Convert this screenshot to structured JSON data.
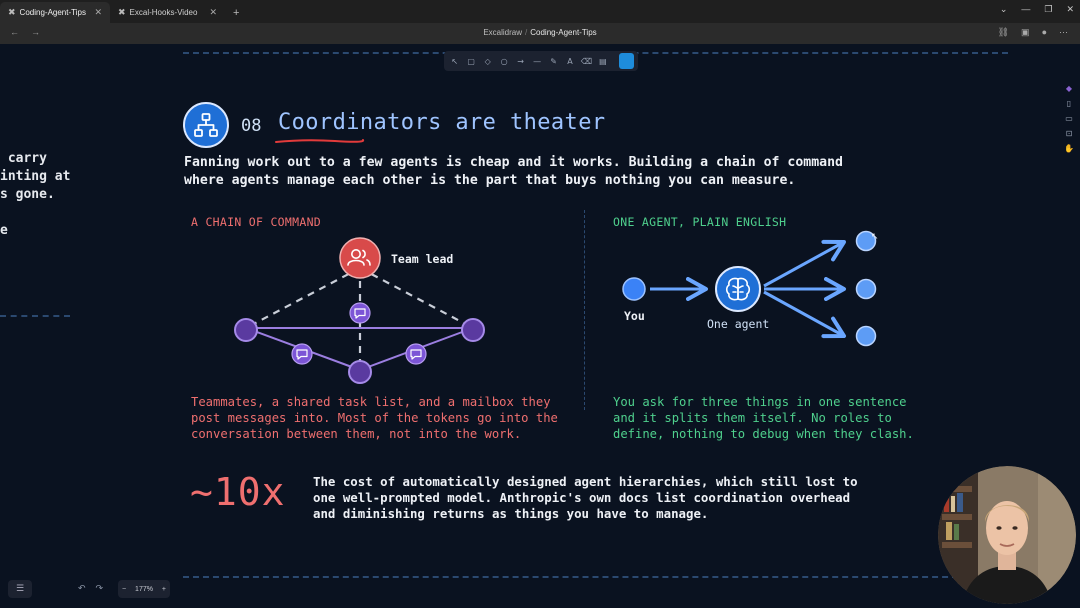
{
  "browser": {
    "tabs": [
      {
        "title": "Coding-Agent-Tips",
        "active": true
      },
      {
        "title": "Excal-Hooks-Video",
        "active": false
      }
    ],
    "breadcrumb": {
      "root": "Excalidraw",
      "separator": "/",
      "current": "Coding-Agent-Tips"
    }
  },
  "left_fragment": {
    "lines": [
      " carry",
      "inting at",
      "s gone.",
      "",
      "e"
    ]
  },
  "section": {
    "number": "08",
    "title": "Coordinators are theater",
    "lead_lines": [
      "Fanning work out to a few agents is cheap and it works. Building a chain of command",
      "where agents manage each other is the part that buys nothing you can measure."
    ]
  },
  "left_panel": {
    "label": "A CHAIN OF COMMAND",
    "node_label": "Team lead",
    "caption_lines": [
      "Teammates, a shared task list, and a mailbox they",
      "post messages into. Most of the tokens go into the",
      "conversation between them, not into the work."
    ]
  },
  "right_panel": {
    "label": "ONE AGENT, PLAIN ENGLISH",
    "you_label": "You",
    "agent_label": "One agent",
    "caption_lines": [
      "You ask for three things in one sentence",
      "and it splits them itself. No roles to",
      "define, nothing to debug when they clash."
    ]
  },
  "stat": {
    "value": "~10x",
    "lines": [
      "The cost of automatically designed agent hierarchies, which still lost to",
      "one well-prompted model. Anthropic's own docs list coordination overhead",
      "and diminishing returns as things you have to manage."
    ]
  },
  "zoom": {
    "value": "177%",
    "minus": "−",
    "plus": "+"
  },
  "colors": {
    "background": "#0a1220",
    "accent_red": "#ef6f6f",
    "accent_green": "#4fd08d",
    "accent_blue": "#1f6fd6",
    "accent_purple": "#8a63d2",
    "title_blue": "#9fc4ff"
  }
}
